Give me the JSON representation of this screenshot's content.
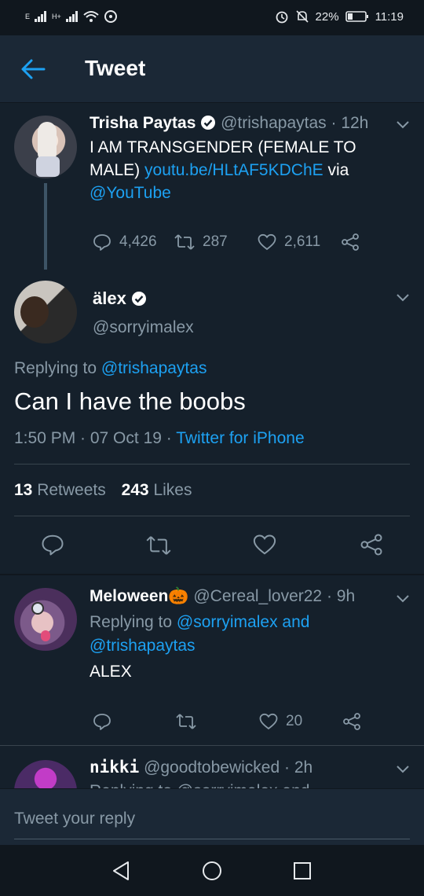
{
  "status": {
    "signal_left": "E",
    "signal_right": "H+",
    "battery": "22%",
    "time": "11:19"
  },
  "header": {
    "title": "Tweet"
  },
  "thread_tweet": {
    "name": "Trisha Paytas",
    "handle": "@trishapaytas",
    "time": "· 12h",
    "text_part1": "I AM TRANSGENDER (FEMALE TO MALE) ",
    "link": "youtu.be/HLtAF5KDChE",
    "text_part2": " via",
    "mention": "@YouTube",
    "replies": "4,426",
    "retweets": "287",
    "likes": "2,611"
  },
  "main_tweet": {
    "name": "älex",
    "handle": "@sorryimalex",
    "replying_prefix": "Replying to ",
    "replying_to": "@trishapaytas",
    "text": "Can I have the boobs",
    "time": "1:50 PM · 07 Oct 19 · ",
    "source": "Twitter for iPhone",
    "retweet_count": "13",
    "retweet_label": " Retweets",
    "like_count": "243",
    "like_label": " Likes"
  },
  "reply1": {
    "name": "Meloween",
    "emoji": "🎃",
    "handle": "@Cereal_lover22",
    "time": "· 9h",
    "replying_prefix": "Replying to ",
    "replying_to_1": "@sorryimalex",
    "and": " and",
    "replying_to_2": "@trishapaytas",
    "text": "ALEX",
    "likes": "20"
  },
  "reply2": {
    "name": "nikki",
    "handle": "@goodtobewicked",
    "time": "· 2h",
    "partial": "Replying to @sorryimalex and"
  },
  "compose": {
    "placeholder": "Tweet your reply"
  },
  "colors": {
    "background": "#15202b",
    "accent": "#1da1f2",
    "muted": "#8899a6"
  }
}
